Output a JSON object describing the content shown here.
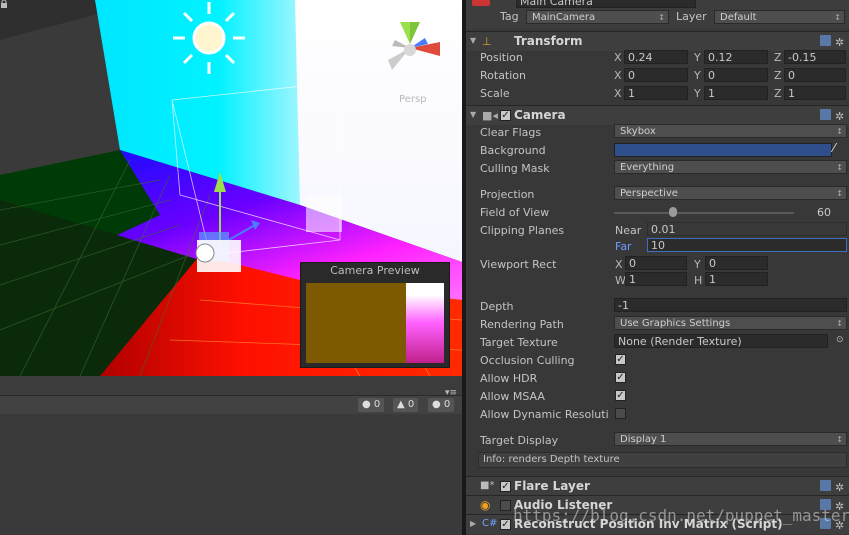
{
  "scene": {
    "persp_label": "Persp",
    "camera_preview_title": "Camera Preview"
  },
  "console": {
    "errors": "0",
    "warnings": "0",
    "logs": "0"
  },
  "inspector": {
    "object_name": "Main Camera",
    "tag_label": "Tag",
    "tag_value": "MainCamera",
    "layer_label": "Layer",
    "layer_value": "Default",
    "transform": {
      "title": "Transform",
      "position_label": "Position",
      "rotation_label": "Rotation",
      "scale_label": "Scale",
      "x": "X",
      "y": "Y",
      "z": "Z",
      "position": [
        "0.24",
        "0.12",
        "-0.15"
      ],
      "rotation": [
        "0",
        "0",
        "0"
      ],
      "scale": [
        "1",
        "1",
        "1"
      ]
    },
    "camera": {
      "title": "Camera",
      "clear_flags_label": "Clear Flags",
      "clear_flags_value": "Skybox",
      "background_label": "Background",
      "background_color": "#2e4f8c",
      "culling_mask_label": "Culling Mask",
      "culling_mask_value": "Everything",
      "projection_label": "Projection",
      "projection_value": "Perspective",
      "fov_label": "Field of View",
      "fov_value": "60",
      "fov_fraction": 0.33,
      "clipping_label": "Clipping Planes",
      "near_label": "Near",
      "near_value": "0.01",
      "far_label": "Far",
      "far_value": "10",
      "viewport_label": "Viewport Rect",
      "vp_x_label": "X",
      "vp_x": "0",
      "vp_y_label": "Y",
      "vp_y": "0",
      "vp_w_label": "W",
      "vp_w": "1",
      "vp_h_label": "H",
      "vp_h": "1",
      "depth_label": "Depth",
      "depth_value": "-1",
      "rendering_path_label": "Rendering Path",
      "rendering_path_value": "Use Graphics Settings",
      "target_texture_label": "Target Texture",
      "target_texture_value": "None (Render Texture)",
      "occlusion_label": "Occlusion Culling",
      "hdr_label": "Allow HDR",
      "msaa_label": "Allow MSAA",
      "dyn_res_label": "Allow Dynamic Resoluti",
      "target_display_label": "Target Display",
      "target_display_value": "Display 1",
      "info": "Info: renders Depth texture"
    },
    "flare_layer_title": "Flare Layer",
    "audio_listener_title": "Audio Listener",
    "reconstruct_title": "Reconstruct Position Inv Matrix (Script)"
  },
  "watermark": "https://blog.csdn.net/puppet_master"
}
